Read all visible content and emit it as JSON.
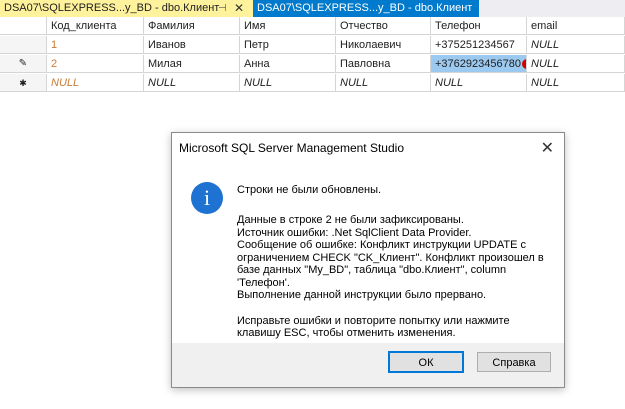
{
  "tabs": [
    {
      "label": "DSA07\\SQLEXPRESS...y_BD - dbo.Клиент",
      "active": true
    },
    {
      "label": "DSA07\\SQLEXPRESS...y_BD - dbo.Клиент",
      "active": false
    }
  ],
  "tab_pin_icon": "⊣",
  "tab_close_icon": "✕",
  "grid": {
    "columns": [
      "Код_клиента",
      "Фамилия",
      "Имя",
      "Отчество",
      "Телефон",
      "email"
    ],
    "rows": [
      {
        "indicator": "",
        "cells": [
          "1",
          "Иванов",
          "Петр",
          "Николаевич",
          "+375251234567",
          "NULL"
        ]
      },
      {
        "indicator": "✎",
        "cells": [
          "2",
          "Милая",
          "Анна",
          "Павловна",
          "+3762923456780",
          "NULL"
        ]
      },
      {
        "indicator": "✱",
        "cells": [
          "NULL",
          "NULL",
          "NULL",
          "NULL",
          "NULL",
          "NULL"
        ]
      }
    ],
    "error_badge": "!"
  },
  "dialog": {
    "title": "Microsoft SQL Server Management Studio",
    "close": "✕",
    "icon": "i",
    "headline": "Строки не были обновлены.",
    "body_lines_1": [
      "Данные в строке 2 не были зафиксированы.",
      "Источник ошибки: .Net SqlClient Data Provider.",
      "Сообщение об ошибке: Конфликт инструкции UPDATE с",
      "ограничением CHECK \"CK_Клиент\". Конфликт произошел в",
      "базе данных \"My_BD\", таблица \"dbo.Клиент\", column",
      "'Телефон'.",
      "Выполнение данной инструкции было прервано."
    ],
    "body_lines_2": [
      "Исправьте ошибки и повторите попытку или нажмите",
      "клавишу ESC, чтобы отменить изменения."
    ],
    "ok_label": "ОК",
    "help_label": "Справка"
  },
  "colors": {
    "tab_active": "#fff29d",
    "tab_inactive": "#007acc",
    "selected_cell": "#9cc9ef",
    "info_icon": "#1e73d2"
  }
}
